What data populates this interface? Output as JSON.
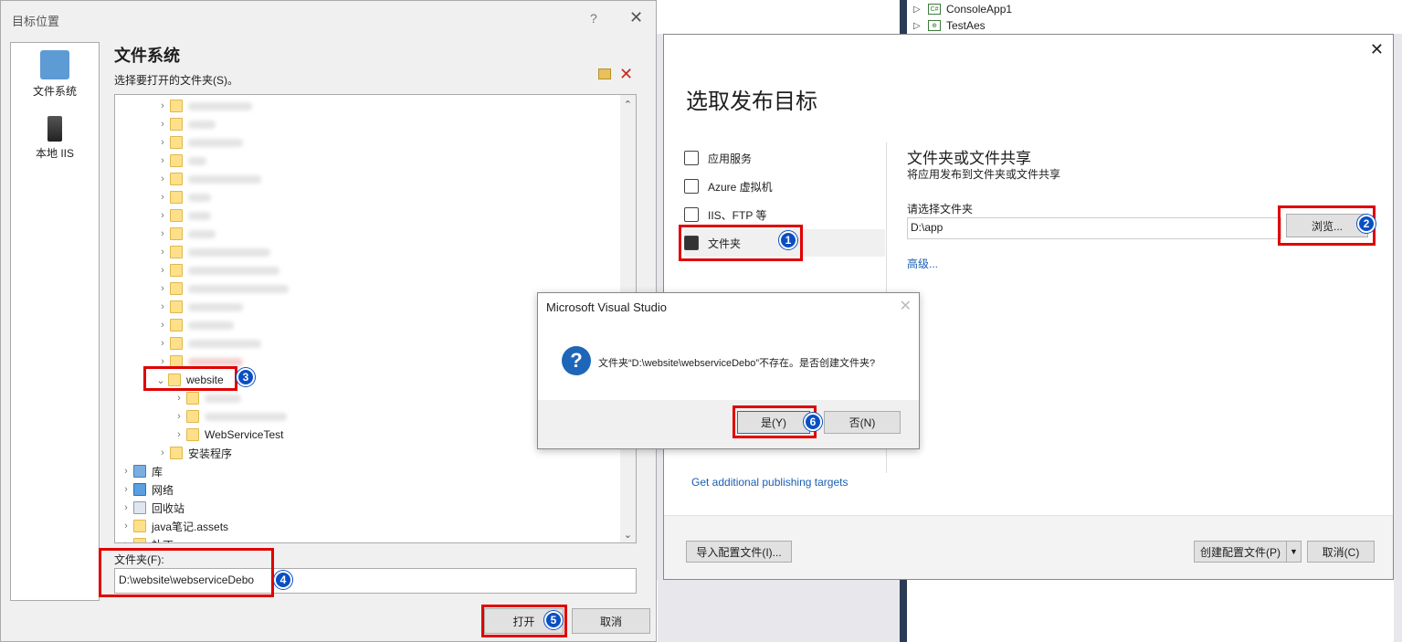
{
  "solution": {
    "items": [
      {
        "label": "ConsoleApp1",
        "icon": "csharp-project-icon"
      },
      {
        "label": "TestAes",
        "icon": "web-project-icon"
      }
    ]
  },
  "folder_dialog": {
    "title": "目标位置",
    "help": "?",
    "close": "✕",
    "nav": [
      {
        "label": "文件系统",
        "icon": "file-system-icon"
      },
      {
        "label": "本地 IIS",
        "icon": "local-iis-icon"
      }
    ],
    "section_title": "文件系统",
    "section_sub": "选择要打开的文件夹(S)。",
    "tree": {
      "website": "website",
      "webservice_test": "WebServiceTest",
      "installer": "安装程序",
      "library": "库",
      "network": "网络",
      "recycle_bin": "回收站",
      "java_notes": "java笔记.assets",
      "partial": "补丁"
    },
    "folder_label": "文件夹(F):",
    "folder_value": "D:\\website\\webserviceDebo",
    "open_label": "打开",
    "cancel_label": "取消"
  },
  "publish_dialog": {
    "close": "✕",
    "title": "选取发布目标",
    "targets": [
      {
        "label": "应用服务",
        "icon": "app-service-icon"
      },
      {
        "label": "Azure 虚拟机",
        "icon": "azure-vm-icon"
      },
      {
        "label": "IIS、FTP 等",
        "icon": "iis-ftp-icon"
      },
      {
        "label": "文件夹",
        "icon": "folder-icon"
      }
    ],
    "right_title": "文件夹或文件共享",
    "right_desc": "将应用发布到文件夹或文件共享",
    "choose_label": "请选择文件夹",
    "folder_value": "D:\\app",
    "browse_label": "浏览...",
    "advanced_label": "高级...",
    "more_targets_label": "Get additional publishing targets",
    "import_label": "导入配置文件(I)...",
    "create_label": "创建配置文件(P)",
    "cancel_label": "取消(C)"
  },
  "msgbox": {
    "title": "Microsoft Visual Studio",
    "close": "✕",
    "message": "文件夹“D:\\website\\webserviceDebo”不存在。是否创建文件夹?",
    "yes_label": "是(Y)",
    "no_label": "否(N)"
  },
  "badges": [
    "1",
    "2",
    "3",
    "4",
    "5",
    "6"
  ],
  "colors": {
    "highlight": "#e00000",
    "badge": "#0a4fc2",
    "link": "#1a5fb4"
  }
}
